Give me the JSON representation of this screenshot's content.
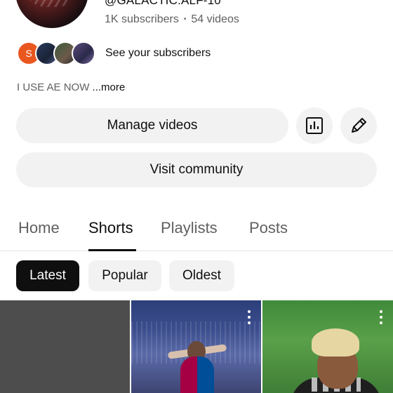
{
  "channel": {
    "handle": "@GALACTIC.ALF-10",
    "subscribers": "1K subscribers",
    "separator": "•",
    "videos": "54 videos",
    "description": "I USE AE NOW",
    "more_label": "...more"
  },
  "subscribers_row": {
    "first_initial": "S",
    "link_label": "See your subscribers"
  },
  "actions": {
    "manage_label": "Manage videos",
    "community_label": "Visit community",
    "analytics_icon": "analytics-icon",
    "edit_icon": "edit-pencil-icon"
  },
  "tabs": [
    {
      "label": "Home"
    },
    {
      "label": "Shorts",
      "active": true
    },
    {
      "label": "Playlists"
    },
    {
      "label": "Posts"
    }
  ],
  "filters": [
    {
      "label": "Latest",
      "active": true
    },
    {
      "label": "Popular"
    },
    {
      "label": "Oldest"
    }
  ],
  "colors": {
    "accent_dark": "#0f0f0f",
    "chip_bg": "#f2f2f2",
    "subscriber_avatar": "#e9571e",
    "secondary_text": "#606060"
  }
}
